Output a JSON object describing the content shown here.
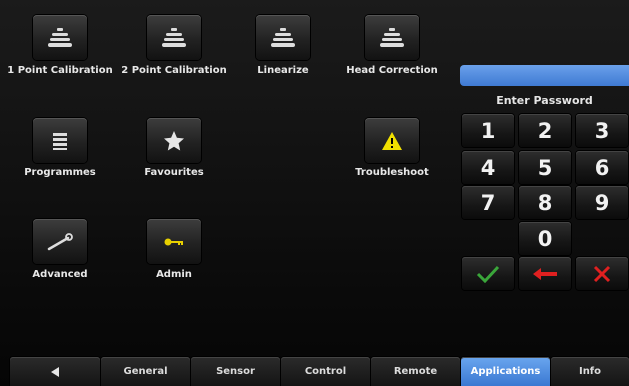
{
  "password": {
    "title": "Enter Password",
    "value": "",
    "keys": [
      "1",
      "2",
      "3",
      "4",
      "5",
      "6",
      "7",
      "8",
      "9",
      "0"
    ],
    "confirm_icon": "check-icon",
    "backspace_icon": "arrow-left-icon",
    "cancel_icon": "x-icon"
  },
  "apps": [
    {
      "label": "1 Point Calibration",
      "icon": "calibration-weights-icon"
    },
    {
      "label": "2 Point Calibration",
      "icon": "calibration-weights-icon"
    },
    {
      "label": "Linearize",
      "icon": "calibration-weights-icon"
    },
    {
      "label": "Head Correction",
      "icon": "calibration-weights-icon"
    },
    {
      "label": "Programmes",
      "icon": "list-icon"
    },
    {
      "label": "Favourites",
      "icon": "star-icon"
    },
    {
      "label": "Troubleshoot",
      "icon": "warning-icon"
    },
    {
      "label": "Advanced",
      "icon": "wrench-icon"
    },
    {
      "label": "Admin",
      "icon": "key-icon"
    }
  ],
  "nav": {
    "back_icon": "back-arrow-icon",
    "tabs": [
      "General",
      "Sensor",
      "Control",
      "Remote",
      "Applications",
      "Info"
    ],
    "active_tab": "Applications"
  },
  "colors": {
    "accent_blue": "#3f7ad3",
    "confirm_green": "#3aa63a",
    "cancel_red": "#e02020",
    "warning_yellow": "#f0e000",
    "key_yellow": "#e8d000"
  }
}
